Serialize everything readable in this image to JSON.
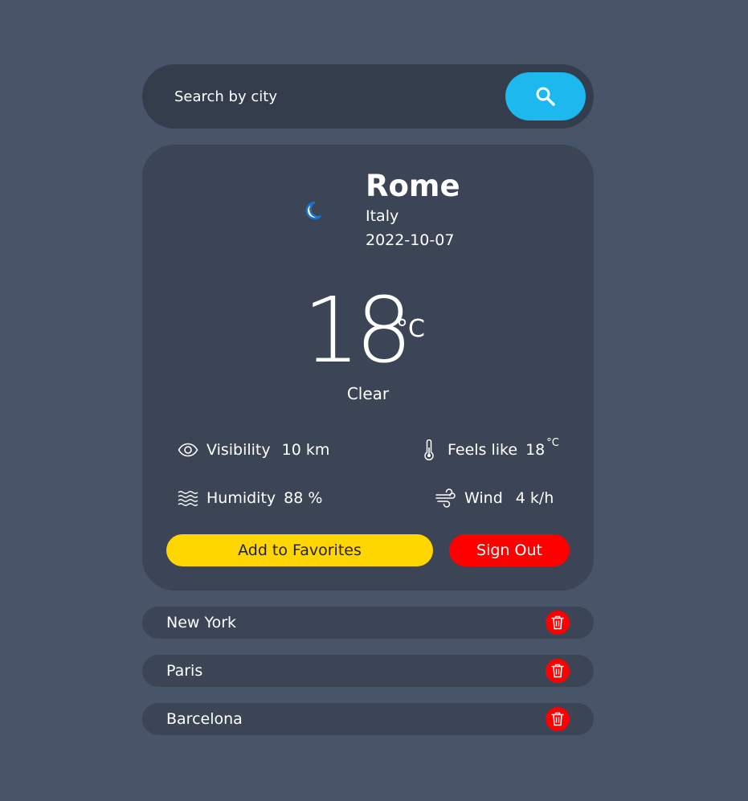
{
  "search": {
    "placeholder": "Search by city",
    "value": "",
    "button_icon": "search-icon"
  },
  "weather": {
    "icon": "moon-icon",
    "city": "Rome",
    "country": "Italy",
    "date": "2022-10-07",
    "temperature": "18",
    "unit": "°C",
    "condition": "Clear"
  },
  "stats": {
    "visibility": {
      "icon": "eye-icon",
      "label": "Visibility",
      "value": "10 km"
    },
    "feels_like": {
      "icon": "thermometer-icon",
      "label": "Feels like",
      "value": "18",
      "unit": "°C"
    },
    "humidity": {
      "icon": "waves-icon",
      "label": "Humidity",
      "value": "88 %"
    },
    "wind": {
      "icon": "wind-icon",
      "label": "Wind",
      "value": "4 k/h"
    }
  },
  "actions": {
    "favorites_label": "Add to Favorites",
    "signout_label": "Sign Out"
  },
  "favorites": [
    {
      "name": "New York",
      "delete_icon": "trash-icon"
    },
    {
      "name": "Paris",
      "delete_icon": "trash-icon"
    },
    {
      "name": "Barcelona",
      "delete_icon": "trash-icon"
    }
  ],
  "colors": {
    "background": "#485568",
    "card": "#3b4555",
    "search_bar": "#343d4c",
    "search_button": "#1cb8ee",
    "favorites_button": "#ffd600",
    "signout_button": "#ff0000",
    "delete_button": "#ff0000"
  }
}
